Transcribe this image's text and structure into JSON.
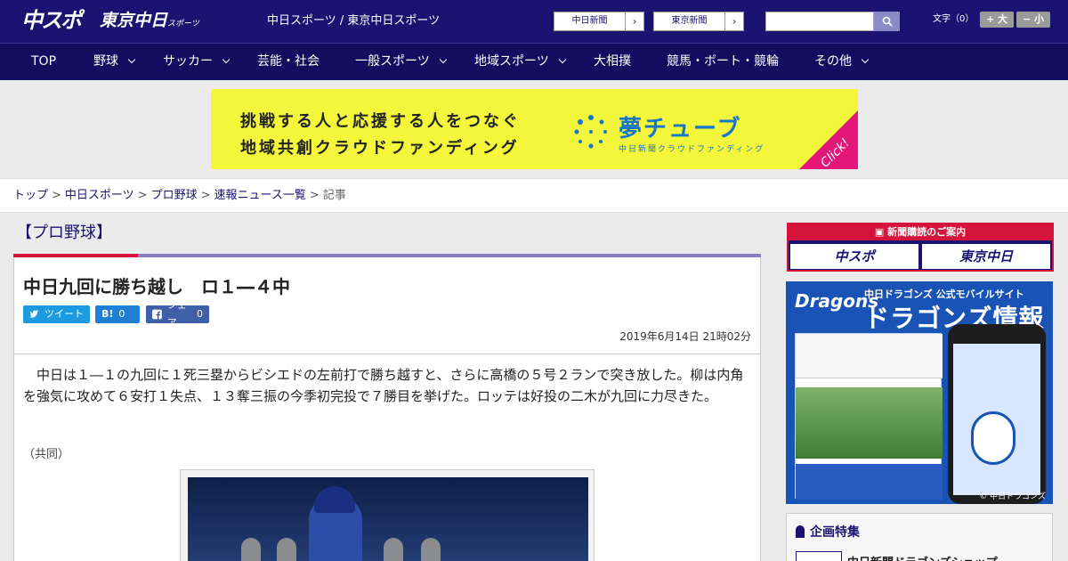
{
  "header": {
    "logo_chuspo": "中スポ",
    "logo_tokyo": "東京中日",
    "logo_tokyo_small": "スポーツ",
    "site_link": "中日スポーツ / 東京中日スポーツ",
    "paper1": "中日新聞",
    "paper2": "東京新聞",
    "search_placeholder": "",
    "fontsize_label": "文字（0）",
    "font_bigger": "+ 大",
    "font_smaller": "− 小"
  },
  "nav": [
    {
      "label": "TOP"
    },
    {
      "label": "野球"
    },
    {
      "label": "サッカー"
    },
    {
      "label": "芸能・社会"
    },
    {
      "label": "一般スポーツ"
    },
    {
      "label": "地域スポーツ"
    },
    {
      "label": "大相撲"
    },
    {
      "label": "競馬・ボート・競輪"
    },
    {
      "label": "その他"
    }
  ],
  "banner": {
    "line1": "挑戦する人と応援する人をつなぐ",
    "line2": "地域共創クラウドファンディング",
    "brand": "夢チューブ",
    "sub": "中日新聞クラウドファンディング",
    "click": "Click!"
  },
  "breadcrumb": {
    "items": [
      "トップ",
      "中日スポーツ",
      "プロ野球",
      "速報ニュース一覧"
    ],
    "current": "記事"
  },
  "article": {
    "category": "【プロ野球】",
    "headline": "中日九回に勝ち越し　ロ１―４中",
    "share_tweet": "ツイート",
    "share_hatena_count": "0",
    "share_fb": "シェア",
    "share_fb_count": "0",
    "date": "2019年6月14日 21時02分",
    "body": "中日は１―１の九回に１死三塁からビシエドの左前打で勝ち越すと、さらに高橋の５号２ランで突き放した。柳は内角を強気に攻めて６安打１失点、１３奪三振の今季初完投で７勝目を挙げた。ロッテは好投の二木が九回に力尽きた。",
    "credit": "（共同）"
  },
  "sidebar": {
    "subscribe_head": "新聞購読のご案内",
    "sub_logo1": "中スポ",
    "sub_logo2": "東京中日",
    "dragons_logo": "Dragons",
    "dragons_top": "中日ドラゴンズ 公式モバイルサイト",
    "dragons_title": "ドラゴンズ情報",
    "dragons_copy": "© 中日ドラゴンズ",
    "feature_title": "企画特集",
    "feature_item": "中日新聞ドラゴンズショップ"
  },
  "colors": {
    "header_bg": "#1a1372",
    "nav_bg": "#120d5e",
    "accent_red": "#d4143b",
    "banner_bg": "#f3f63a"
  }
}
